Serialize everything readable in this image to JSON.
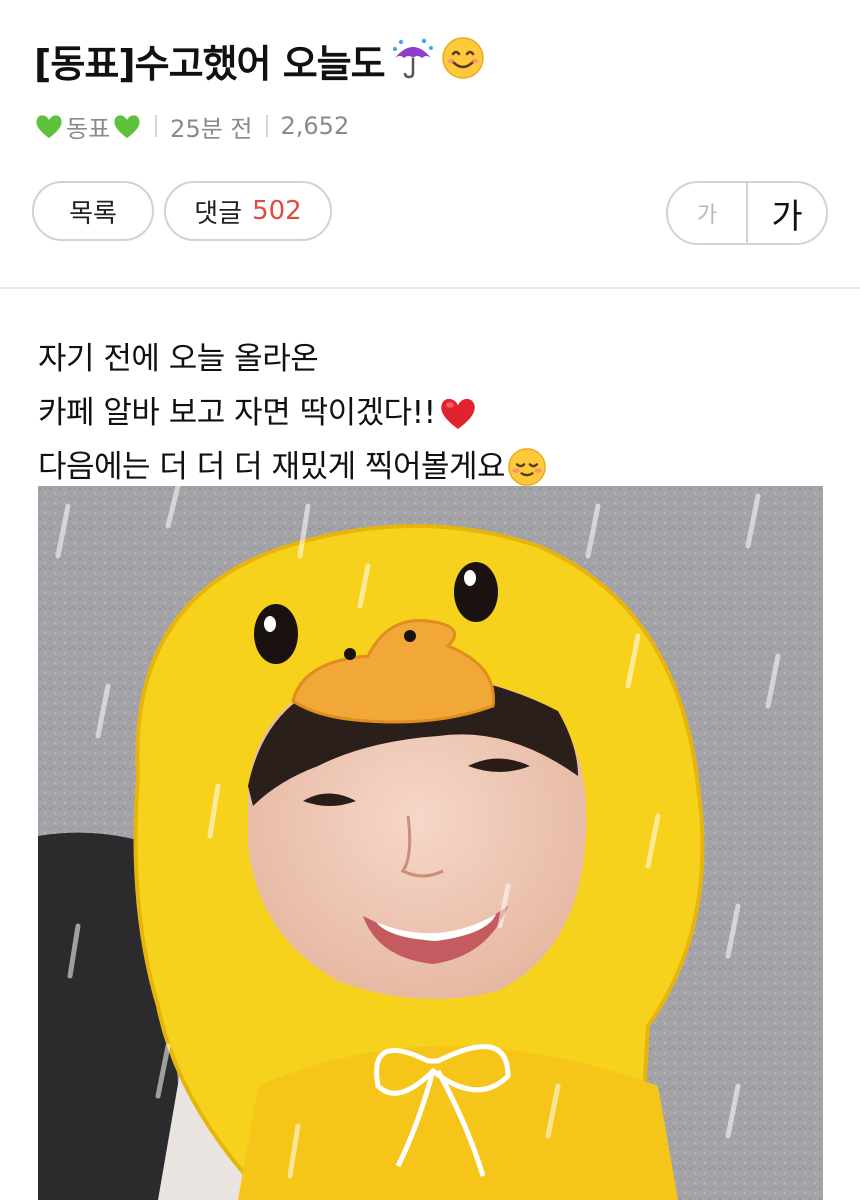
{
  "post": {
    "title": "[동표]수고했어 오늘도",
    "title_emojis": [
      "umbrella-rain-icon",
      "smiling-face-icon"
    ],
    "author": "동표",
    "author_emojis": [
      "green-heart-icon",
      "green-heart-icon"
    ],
    "time": "25분 전",
    "views": "2,652"
  },
  "toolbar": {
    "list_label": "목록",
    "comments_label": "댓글",
    "comments_count": "502",
    "font_small_label": "가",
    "font_large_label": "가"
  },
  "content": {
    "lines": [
      "자기 전에 오늘 올라온",
      "카페 알바 보고 자면 딱이겠다!!",
      "다음에는 더 더 더 재밌게 찍어볼게요"
    ],
    "line_emojis": [
      "",
      "red-heart-icon",
      "blushing-face-icon"
    ]
  },
  "colors": {
    "accent_count": "#e04a3f",
    "border": "#d2d2d2",
    "meta_text": "#8a8a8a",
    "duck_yellow": "#f7d21d",
    "duck_beak": "#f2a838"
  }
}
